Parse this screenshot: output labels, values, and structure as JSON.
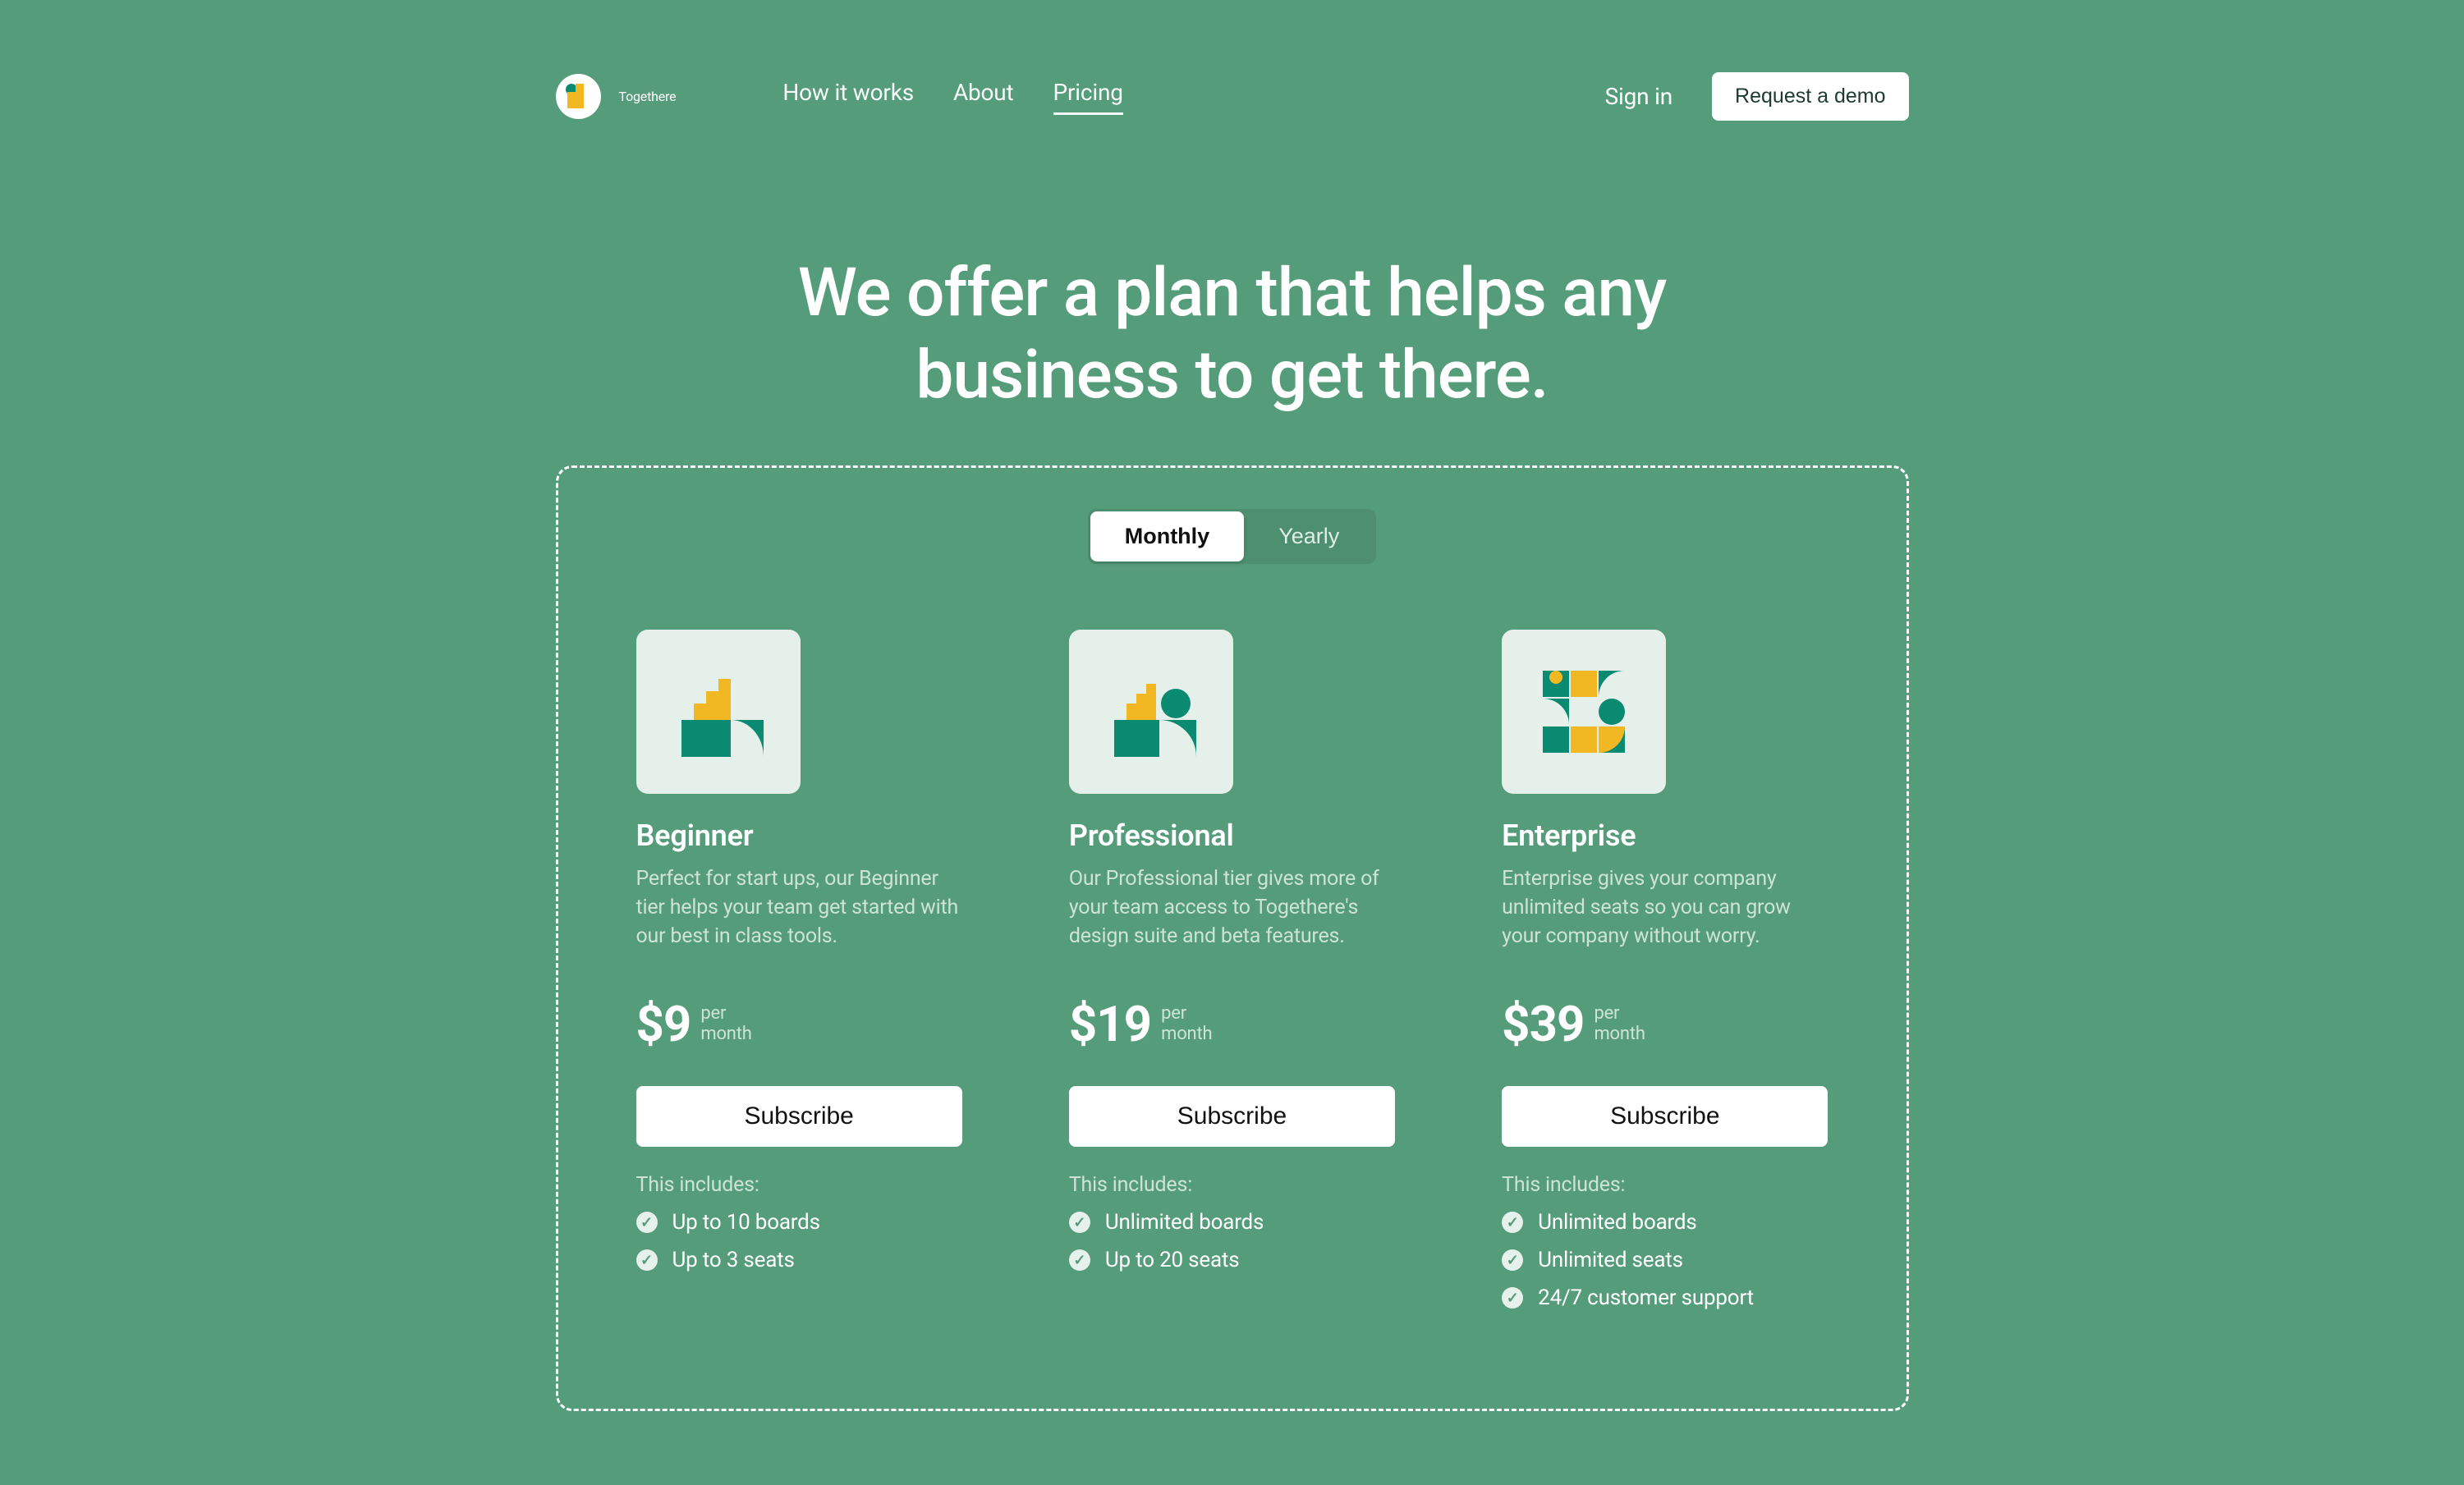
{
  "brand": {
    "name": "Togethere"
  },
  "nav": {
    "items": [
      {
        "label": "How it works",
        "active": false
      },
      {
        "label": "About",
        "active": false
      },
      {
        "label": "Pricing",
        "active": true
      }
    ],
    "signin": "Sign in",
    "demo": "Request a demo"
  },
  "headline_line1": "We offer a plan that helps any",
  "headline_line2": "business to get there.",
  "toggle": {
    "options": [
      {
        "label": "Monthly",
        "active": true
      },
      {
        "label": "Yearly",
        "active": false
      }
    ]
  },
  "per_line1": "per",
  "per_line2": "month",
  "subscribe_label": "Subscribe",
  "includes_label": "This includes:",
  "plans": [
    {
      "name": "Beginner",
      "desc": "Perfect for start ups, our Beginner tier helps your team get started with our best in class tools.",
      "price": "$9",
      "features": [
        "Up to 10 boards",
        "Up to 3 seats"
      ]
    },
    {
      "name": "Professional",
      "desc": "Our Professional tier gives more of your team access to Togethere's design suite and beta features.",
      "price": "$19",
      "features": [
        "Unlimited boards",
        "Up to 20 seats"
      ]
    },
    {
      "name": "Enterprise",
      "desc": "Enterprise gives your company unlimited seats so you can grow your company without worry.",
      "price": "$39",
      "features": [
        "Unlimited boards",
        "Unlimited seats",
        "24/7 customer support"
      ]
    }
  ]
}
